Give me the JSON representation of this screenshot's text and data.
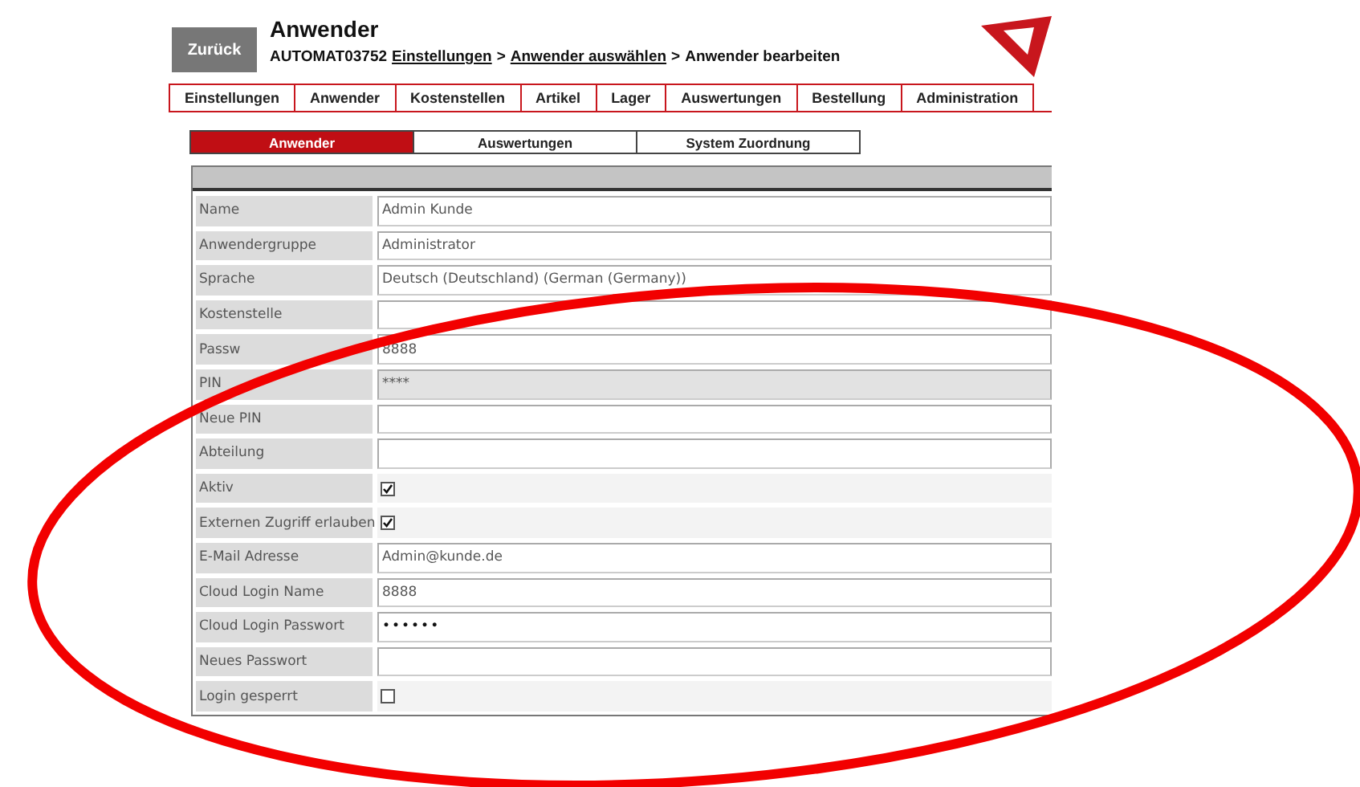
{
  "header": {
    "back_button": "Zurück",
    "title": "Anwender",
    "breadcrumb": {
      "device": "AUTOMAT03752",
      "links": [
        "Einstellungen",
        "Anwender auswählen"
      ],
      "separators": [
        ">",
        ">"
      ],
      "current": "Anwender bearbeiten"
    }
  },
  "nav_tabs": [
    {
      "label": "Einstellungen",
      "selected": false
    },
    {
      "label": "Anwender",
      "selected": false
    },
    {
      "label": "Kostenstellen",
      "selected": false
    },
    {
      "label": "Artikel",
      "selected": false
    },
    {
      "label": "Lager",
      "selected": false
    },
    {
      "label": "Auswertungen",
      "selected": false
    },
    {
      "label": "Bestellung",
      "selected": false
    },
    {
      "label": "Administration",
      "selected": false
    }
  ],
  "sub_tabs": [
    {
      "label": "Anwender",
      "selected": true
    },
    {
      "label": "Auswertungen",
      "selected": false
    },
    {
      "label": "System Zuordnung",
      "selected": false
    }
  ],
  "form": {
    "rows": [
      {
        "label": "Name",
        "kind": "text",
        "value": "Admin Kunde"
      },
      {
        "label": "Anwendergruppe",
        "kind": "text",
        "value": "Administrator"
      },
      {
        "label": "Sprache",
        "kind": "text",
        "value": "Deutsch (Deutschland) (German (Germany))"
      },
      {
        "label": "Kostenstelle",
        "kind": "text"
      },
      {
        "label": "Passw",
        "kind": "text",
        "value": "8888"
      },
      {
        "label": "PIN",
        "kind": "disabled",
        "value": "****"
      },
      {
        "label": "Neue PIN",
        "kind": "text"
      },
      {
        "label": "Abteilung",
        "kind": "text"
      },
      {
        "label": "Aktiv",
        "kind": "checkbox",
        "checked": true
      },
      {
        "label": "Externen Zugriff erlauben",
        "kind": "checkbox",
        "checked": true
      },
      {
        "label": "E-Mail Adresse",
        "kind": "text",
        "value": "Admin@kunde.de"
      },
      {
        "label": "Cloud Login Name",
        "kind": "text",
        "value": "8888"
      },
      {
        "label": "Cloud Login Passwort",
        "kind": "password",
        "value": "••••••"
      },
      {
        "label": "Neues Passwort",
        "kind": "text"
      },
      {
        "label": "Login gesperrt",
        "kind": "checkbox",
        "checked": false
      }
    ]
  }
}
